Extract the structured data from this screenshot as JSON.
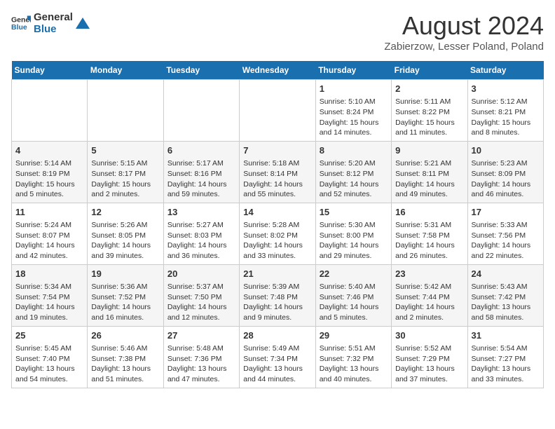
{
  "header": {
    "logo_general": "General",
    "logo_blue": "Blue",
    "title": "August 2024",
    "subtitle": "Zabierzow, Lesser Poland, Poland"
  },
  "days_of_week": [
    "Sunday",
    "Monday",
    "Tuesday",
    "Wednesday",
    "Thursday",
    "Friday",
    "Saturday"
  ],
  "weeks": [
    [
      {
        "day": "",
        "info": ""
      },
      {
        "day": "",
        "info": ""
      },
      {
        "day": "",
        "info": ""
      },
      {
        "day": "",
        "info": ""
      },
      {
        "day": "1",
        "info": "Sunrise: 5:10 AM\nSunset: 8:24 PM\nDaylight: 15 hours\nand 14 minutes."
      },
      {
        "day": "2",
        "info": "Sunrise: 5:11 AM\nSunset: 8:22 PM\nDaylight: 15 hours\nand 11 minutes."
      },
      {
        "day": "3",
        "info": "Sunrise: 5:12 AM\nSunset: 8:21 PM\nDaylight: 15 hours\nand 8 minutes."
      }
    ],
    [
      {
        "day": "4",
        "info": "Sunrise: 5:14 AM\nSunset: 8:19 PM\nDaylight: 15 hours\nand 5 minutes."
      },
      {
        "day": "5",
        "info": "Sunrise: 5:15 AM\nSunset: 8:17 PM\nDaylight: 15 hours\nand 2 minutes."
      },
      {
        "day": "6",
        "info": "Sunrise: 5:17 AM\nSunset: 8:16 PM\nDaylight: 14 hours\nand 59 minutes."
      },
      {
        "day": "7",
        "info": "Sunrise: 5:18 AM\nSunset: 8:14 PM\nDaylight: 14 hours\nand 55 minutes."
      },
      {
        "day": "8",
        "info": "Sunrise: 5:20 AM\nSunset: 8:12 PM\nDaylight: 14 hours\nand 52 minutes."
      },
      {
        "day": "9",
        "info": "Sunrise: 5:21 AM\nSunset: 8:11 PM\nDaylight: 14 hours\nand 49 minutes."
      },
      {
        "day": "10",
        "info": "Sunrise: 5:23 AM\nSunset: 8:09 PM\nDaylight: 14 hours\nand 46 minutes."
      }
    ],
    [
      {
        "day": "11",
        "info": "Sunrise: 5:24 AM\nSunset: 8:07 PM\nDaylight: 14 hours\nand 42 minutes."
      },
      {
        "day": "12",
        "info": "Sunrise: 5:26 AM\nSunset: 8:05 PM\nDaylight: 14 hours\nand 39 minutes."
      },
      {
        "day": "13",
        "info": "Sunrise: 5:27 AM\nSunset: 8:03 PM\nDaylight: 14 hours\nand 36 minutes."
      },
      {
        "day": "14",
        "info": "Sunrise: 5:28 AM\nSunset: 8:02 PM\nDaylight: 14 hours\nand 33 minutes."
      },
      {
        "day": "15",
        "info": "Sunrise: 5:30 AM\nSunset: 8:00 PM\nDaylight: 14 hours\nand 29 minutes."
      },
      {
        "day": "16",
        "info": "Sunrise: 5:31 AM\nSunset: 7:58 PM\nDaylight: 14 hours\nand 26 minutes."
      },
      {
        "day": "17",
        "info": "Sunrise: 5:33 AM\nSunset: 7:56 PM\nDaylight: 14 hours\nand 22 minutes."
      }
    ],
    [
      {
        "day": "18",
        "info": "Sunrise: 5:34 AM\nSunset: 7:54 PM\nDaylight: 14 hours\nand 19 minutes."
      },
      {
        "day": "19",
        "info": "Sunrise: 5:36 AM\nSunset: 7:52 PM\nDaylight: 14 hours\nand 16 minutes."
      },
      {
        "day": "20",
        "info": "Sunrise: 5:37 AM\nSunset: 7:50 PM\nDaylight: 14 hours\nand 12 minutes."
      },
      {
        "day": "21",
        "info": "Sunrise: 5:39 AM\nSunset: 7:48 PM\nDaylight: 14 hours\nand 9 minutes."
      },
      {
        "day": "22",
        "info": "Sunrise: 5:40 AM\nSunset: 7:46 PM\nDaylight: 14 hours\nand 5 minutes."
      },
      {
        "day": "23",
        "info": "Sunrise: 5:42 AM\nSunset: 7:44 PM\nDaylight: 14 hours\nand 2 minutes."
      },
      {
        "day": "24",
        "info": "Sunrise: 5:43 AM\nSunset: 7:42 PM\nDaylight: 13 hours\nand 58 minutes."
      }
    ],
    [
      {
        "day": "25",
        "info": "Sunrise: 5:45 AM\nSunset: 7:40 PM\nDaylight: 13 hours\nand 54 minutes."
      },
      {
        "day": "26",
        "info": "Sunrise: 5:46 AM\nSunset: 7:38 PM\nDaylight: 13 hours\nand 51 minutes."
      },
      {
        "day": "27",
        "info": "Sunrise: 5:48 AM\nSunset: 7:36 PM\nDaylight: 13 hours\nand 47 minutes."
      },
      {
        "day": "28",
        "info": "Sunrise: 5:49 AM\nSunset: 7:34 PM\nDaylight: 13 hours\nand 44 minutes."
      },
      {
        "day": "29",
        "info": "Sunrise: 5:51 AM\nSunset: 7:32 PM\nDaylight: 13 hours\nand 40 minutes."
      },
      {
        "day": "30",
        "info": "Sunrise: 5:52 AM\nSunset: 7:29 PM\nDaylight: 13 hours\nand 37 minutes."
      },
      {
        "day": "31",
        "info": "Sunrise: 5:54 AM\nSunset: 7:27 PM\nDaylight: 13 hours\nand 33 minutes."
      }
    ]
  ]
}
